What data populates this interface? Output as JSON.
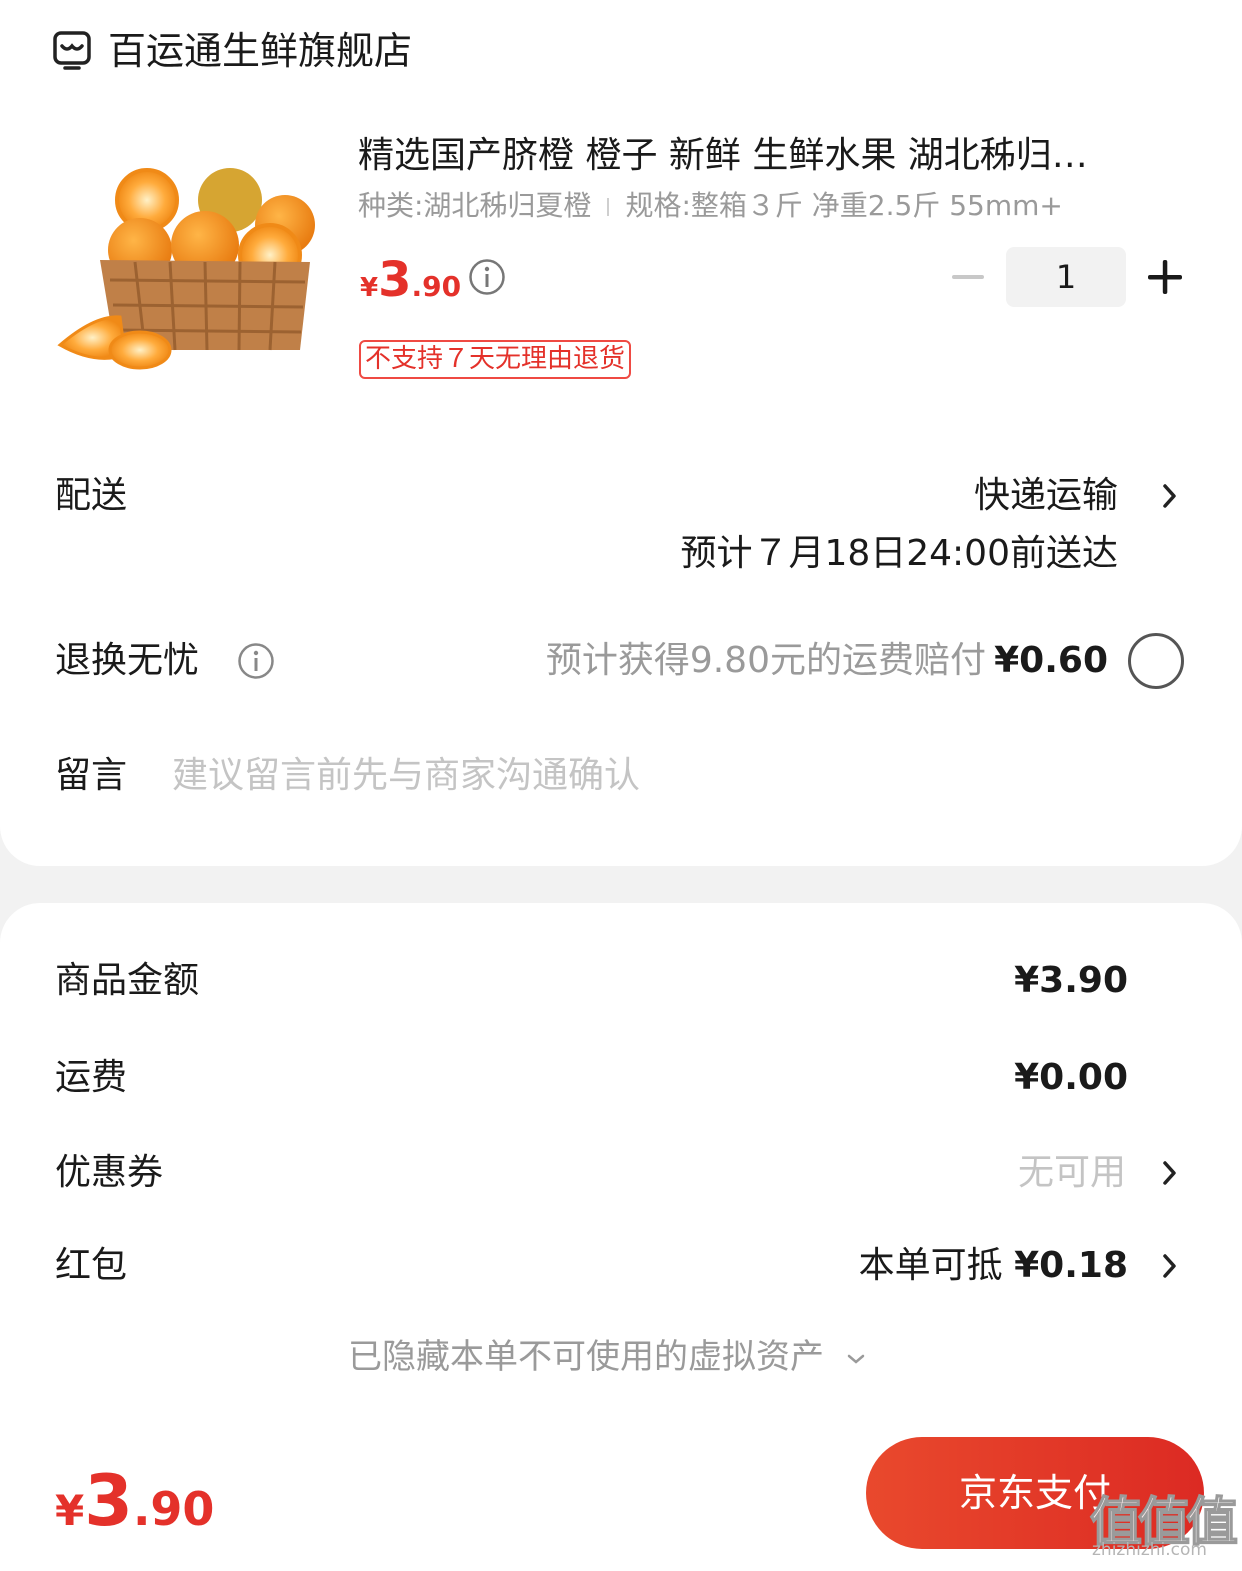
{
  "shop": {
    "name": "百运通生鲜旗舰店",
    "icon": "store-icon"
  },
  "product": {
    "title": "精选国产脐橙 橙子  新鲜 生鲜水果 湖北秭归…",
    "spec_type": "种类:湖北秭归夏橙",
    "spec_size": "规格:整箱３斤 净重2.5斤 55mm+",
    "price": {
      "currency": "¥",
      "integer": "3",
      "decimal": ".90"
    },
    "quantity": "1",
    "tag": "不支持７天无理由退货"
  },
  "delivery": {
    "label": "配送",
    "method": "快递运输",
    "eta": "预计７月18日24:00前送达"
  },
  "return_worry_free": {
    "label": "退换无忧",
    "description": "预计获得9.80元的运费赔付",
    "price": "¥0.60"
  },
  "message": {
    "label": "留言",
    "placeholder": "建议留言前先与商家沟通确认"
  },
  "summary": {
    "goods_amount_label": "商品金额",
    "goods_amount": "¥3.90",
    "shipping_label": "运费",
    "shipping": "¥0.00",
    "coupon_label": "优惠券",
    "coupon_value": "无可用",
    "redpacket_label": "红包",
    "redpacket_prefix": "本单可抵",
    "redpacket_amount": "¥0.18",
    "hidden_assets": "已隐藏本单不可使用的虚拟资产"
  },
  "footer": {
    "total": {
      "currency": "¥",
      "integer": "3",
      "decimal": ".90"
    },
    "pay_button": "京东支付",
    "watermark": "值值值",
    "watermark_url": "zhizhizhi.com"
  },
  "colors": {
    "accent": "#e4312a",
    "background": "#f2f2f2"
  }
}
